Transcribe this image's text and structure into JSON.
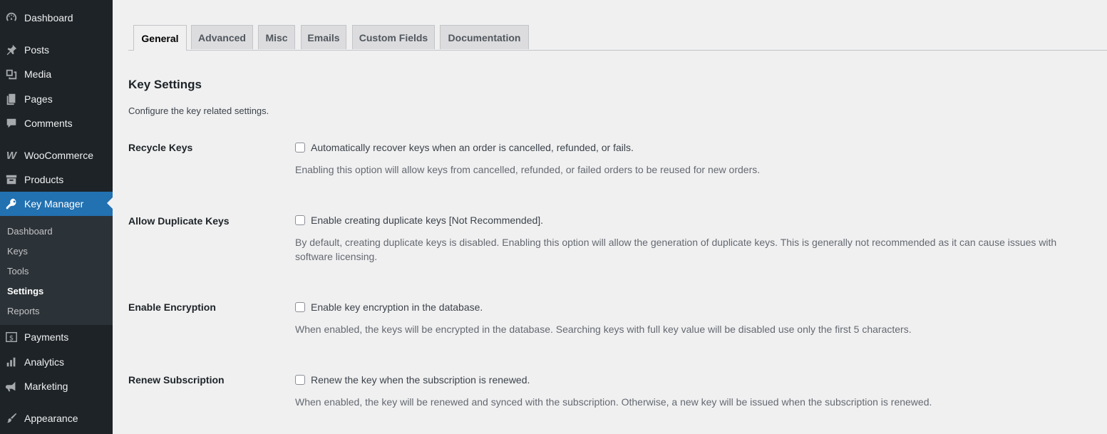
{
  "sidebar": {
    "items": [
      {
        "label": "Dashboard",
        "icon": "dashboard-icon"
      },
      {
        "label": "Posts",
        "icon": "pin-icon"
      },
      {
        "label": "Media",
        "icon": "media-icon"
      },
      {
        "label": "Pages",
        "icon": "pages-icon"
      },
      {
        "label": "Comments",
        "icon": "comment-icon"
      },
      {
        "label": "WooCommerce",
        "icon": "woocommerce-icon"
      },
      {
        "label": "Products",
        "icon": "archive-icon"
      },
      {
        "label": "Key Manager",
        "icon": "key-icon"
      },
      {
        "label": "Payments",
        "icon": "dollar-icon"
      },
      {
        "label": "Analytics",
        "icon": "bar-chart-icon"
      },
      {
        "label": "Marketing",
        "icon": "megaphone-icon"
      },
      {
        "label": "Appearance",
        "icon": "brush-icon"
      }
    ],
    "submenu": [
      "Dashboard",
      "Keys",
      "Tools",
      "Settings",
      "Reports"
    ],
    "active_item": "Key Manager",
    "current_submenu": "Settings"
  },
  "tabs": [
    "General",
    "Advanced",
    "Misc",
    "Emails",
    "Custom Fields",
    "Documentation"
  ],
  "active_tab": "General",
  "section": {
    "title": "Key Settings",
    "description": "Configure the key related settings."
  },
  "settings": [
    {
      "label": "Recycle Keys",
      "checkbox_label": "Automatically recover keys when an order is cancelled, refunded, or fails.",
      "checked": false,
      "description": "Enabling this option will allow keys from cancelled, refunded, or failed orders to be reused for new orders."
    },
    {
      "label": "Allow Duplicate Keys",
      "checkbox_label": "Enable creating duplicate keys [Not Recommended].",
      "checked": false,
      "description": "By default, creating duplicate keys is disabled. Enabling this option will allow the generation of duplicate keys. This is generally not recommended as it can cause issues with software licensing."
    },
    {
      "label": "Enable Encryption",
      "checkbox_label": "Enable key encryption in the database.",
      "checked": false,
      "description": "When enabled, the keys will be encrypted in the database. Searching keys with full key value will be disabled use only the first 5 characters."
    },
    {
      "label": "Renew Subscription",
      "checkbox_label": "Renew the key when the subscription is renewed.",
      "checked": false,
      "description": "When enabled, the key will be renewed and synced with the subscription. Otherwise, a new key will be issued when the subscription is renewed."
    }
  ],
  "colors": {
    "sidebar_bg": "#1d2327",
    "submenu_bg": "#2c3338",
    "accent": "#2271b1",
    "page_bg": "#f0f0f1"
  }
}
